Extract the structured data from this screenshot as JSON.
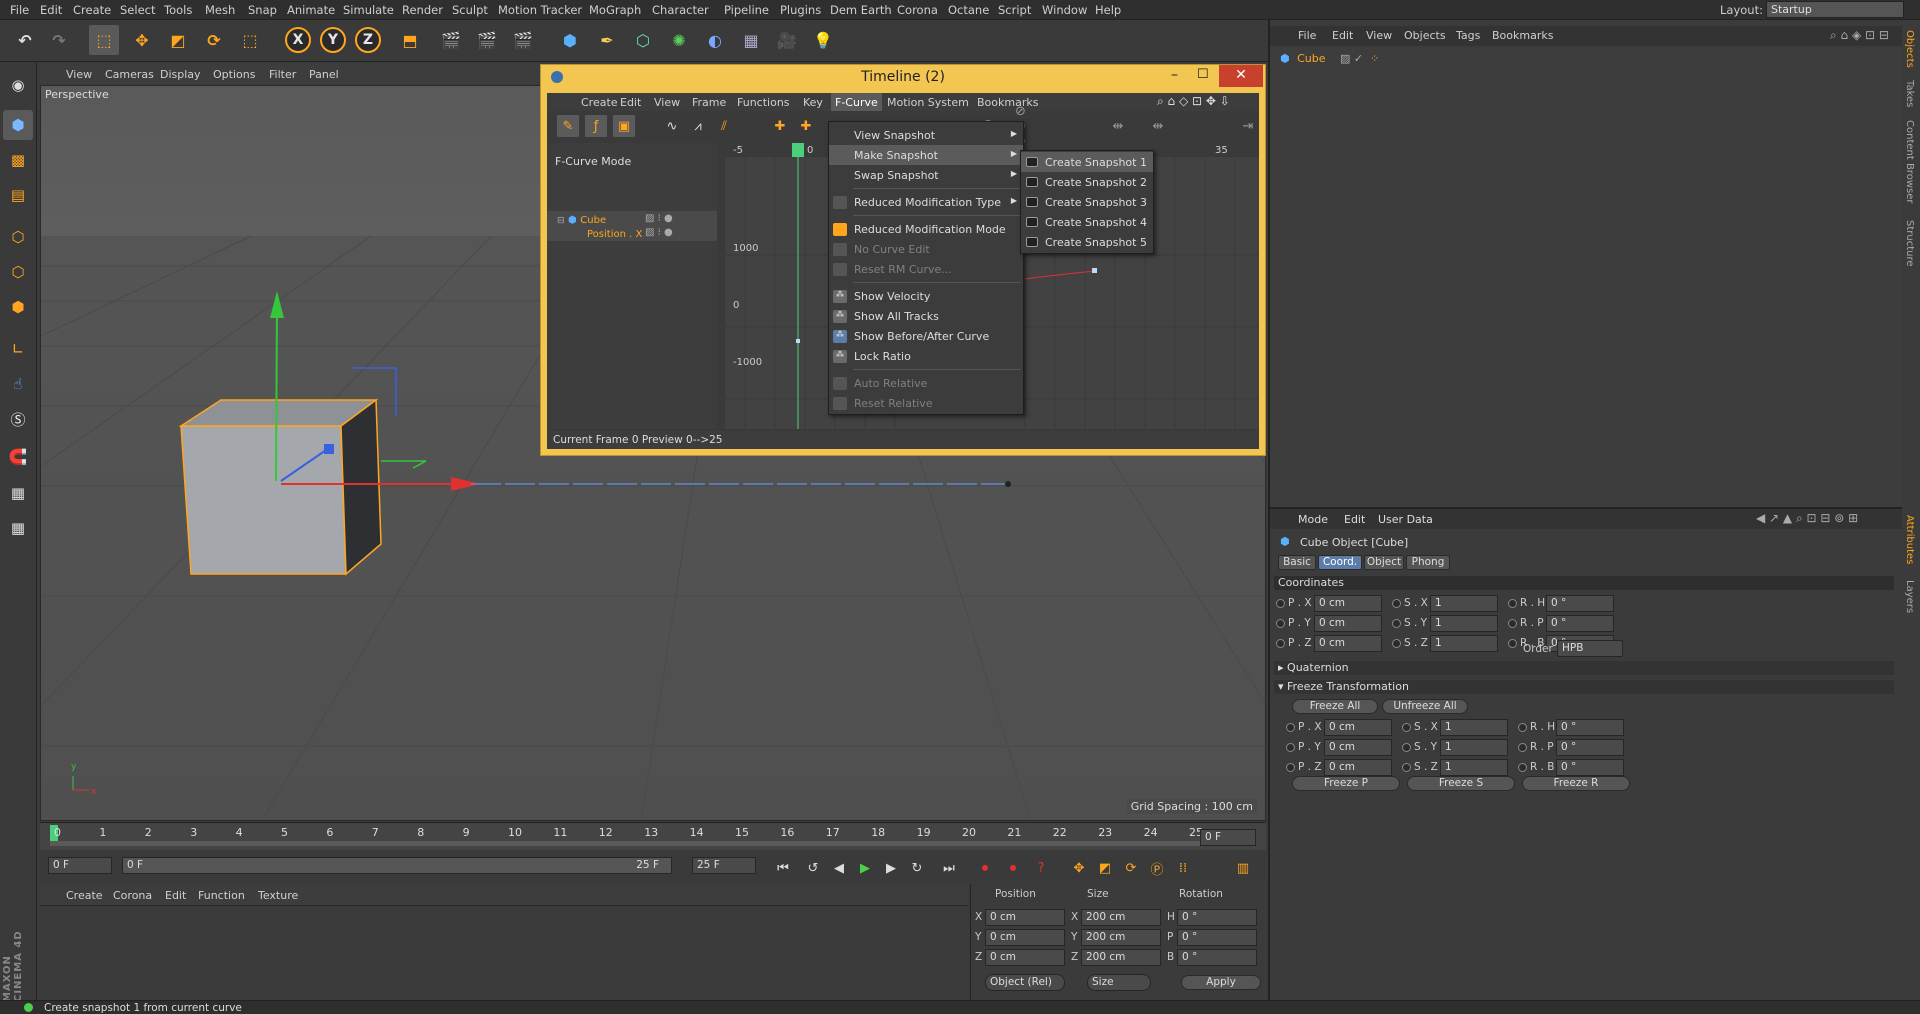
{
  "menubar": {
    "items": [
      "File",
      "Edit",
      "Create",
      "Select",
      "Tools",
      "Mesh",
      "Snap",
      "Animate",
      "Simulate",
      "Render",
      "Sculpt",
      "Motion Tracker",
      "MoGraph",
      "Character",
      "Pipeline",
      "Plugins",
      "Dem Earth",
      "Corona",
      "Octane",
      "Script",
      "Window",
      "Help"
    ],
    "layout_label": "Layout:",
    "layout_value": "Startup"
  },
  "toolbar": {
    "axis_x": "X",
    "axis_y": "Y",
    "axis_z": "Z"
  },
  "viewport": {
    "menu": [
      "View",
      "Cameras",
      "Display",
      "Options",
      "Filter",
      "Panel"
    ],
    "camera_label": "Perspective",
    "grid_spacing": "Grid Spacing : 100 cm"
  },
  "timeline_ruler": {
    "ticks": [
      "0",
      "1",
      "2",
      "3",
      "4",
      "5",
      "6",
      "7",
      "8",
      "9",
      "10",
      "11",
      "12",
      "13",
      "14",
      "15",
      "16",
      "17",
      "18",
      "19",
      "20",
      "21",
      "22",
      "23",
      "24",
      "25"
    ],
    "current_frame": "0 F"
  },
  "transport": {
    "start_field": "0 F",
    "range_start": "0 F",
    "range_end": "25 F",
    "end_field": "25 F"
  },
  "material_manager": {
    "menu": [
      "Create",
      "Corona",
      "Edit",
      "Function",
      "Texture"
    ]
  },
  "coordinate_manager": {
    "headers": {
      "position": "Position",
      "size": "Size",
      "rotation": "Rotation"
    },
    "rows": [
      {
        "axis": "X",
        "pos": "0 cm",
        "size_axis": "X",
        "size": "200 cm",
        "rot_axis": "H",
        "rot": "0 °"
      },
      {
        "axis": "Y",
        "pos": "0 cm",
        "size_axis": "Y",
        "size": "200 cm",
        "rot_axis": "P",
        "rot": "0 °"
      },
      {
        "axis": "Z",
        "pos": "0 cm",
        "size_axis": "Z",
        "size": "200 cm",
        "rot_axis": "B",
        "rot": "0 °"
      }
    ],
    "mode_select": "Object (Rel)",
    "size_select": "Size",
    "apply_label": "Apply"
  },
  "status_bar": {
    "text": "Create snapshot 1 from current curve"
  },
  "object_manager": {
    "menu": [
      "File",
      "Edit",
      "View",
      "Objects",
      "Tags",
      "Bookmarks"
    ],
    "object_name": "Cube"
  },
  "side_tabs": [
    "Objects",
    "Takes",
    "Content Browser",
    "Structure"
  ],
  "side_tabs_lower": [
    "Attributes",
    "Layers"
  ],
  "attributes": {
    "menu": [
      "Mode",
      "Edit",
      "User Data"
    ],
    "object_title": "Cube Object [Cube]",
    "tabs": [
      "Basic",
      "Coord.",
      "Object",
      "Phong"
    ],
    "active_tab": "Coord.",
    "section_coordinates": "Coordinates",
    "coords": [
      {
        "p_label": "P . X",
        "p_val": "0 cm",
        "s_label": "S . X",
        "s_val": "1",
        "r_label": "R . H",
        "r_val": "0 °"
      },
      {
        "p_label": "P . Y",
        "p_val": "0 cm",
        "s_label": "S . Y",
        "s_val": "1",
        "r_label": "R . P",
        "r_val": "0 °"
      },
      {
        "p_label": "P . Z",
        "p_val": "0 cm",
        "s_label": "S . Z",
        "s_val": "1",
        "r_label": "R . B",
        "r_val": "0 °"
      }
    ],
    "order_label": "Order",
    "order_value": "HPB",
    "section_quaternion": "Quaternion",
    "section_freeze": "Freeze Transformation",
    "freeze_all": "Freeze All",
    "unfreeze_all": "Unfreeze All",
    "freeze_coords": [
      {
        "p_label": "P . X",
        "p_val": "0 cm",
        "s_label": "S . X",
        "s_val": "1",
        "r_label": "R . H",
        "r_val": "0 °"
      },
      {
        "p_label": "P . Y",
        "p_val": "0 cm",
        "s_label": "S . Y",
        "s_val": "1",
        "r_label": "R . P",
        "r_val": "0 °"
      },
      {
        "p_label": "P . Z",
        "p_val": "0 cm",
        "s_label": "S . Z",
        "s_val": "1",
        "r_label": "R . B",
        "r_val": "0 °"
      }
    ],
    "freeze_p": "Freeze P",
    "freeze_s": "Freeze S",
    "freeze_r": "Freeze R"
  },
  "timeline_window": {
    "title": "Timeline (2)",
    "menu": [
      "Create",
      "Edit",
      "View",
      "Frame",
      "Functions",
      "Key",
      "F-Curve",
      "Motion System",
      "Bookmarks"
    ],
    "active_menu": "F-Curve",
    "mode_label": "F-Curve Mode",
    "tracks": [
      {
        "name": "Cube"
      },
      {
        "name": "Position . X"
      }
    ],
    "frame_labels": [
      "-5",
      "0",
      "35"
    ],
    "value_labels": [
      "1000",
      "0",
      "-1000"
    ],
    "status": "Current Frame  0  Preview  0-->25"
  },
  "fcurve_menu": {
    "items": [
      {
        "label": "View Snapshot",
        "sub": true,
        "disabled": false
      },
      {
        "label": "Make Snapshot",
        "sub": true,
        "disabled": false,
        "highlight": true
      },
      {
        "label": "Swap Snapshot",
        "sub": true,
        "disabled": false
      },
      {
        "label": "Reduced Modification Type",
        "sub": true,
        "disabled": false
      },
      {
        "label": "Reduced Modification Mode",
        "disabled": false
      },
      {
        "label": "No Curve Edit",
        "disabled": true
      },
      {
        "label": "Reset RM Curve...",
        "disabled": true
      },
      {
        "label": "Show Velocity",
        "disabled": false
      },
      {
        "label": "Show All Tracks",
        "disabled": false
      },
      {
        "label": "Show Before/After Curve",
        "disabled": false
      },
      {
        "label": "Lock Ratio",
        "disabled": false
      },
      {
        "label": "Auto Relative",
        "disabled": true
      },
      {
        "label": "Reset Relative",
        "disabled": true
      }
    ]
  },
  "snapshot_submenu": {
    "items": [
      "Create Snapshot 1",
      "Create Snapshot 2",
      "Create Snapshot 3",
      "Create Snapshot 4",
      "Create Snapshot 5"
    ]
  },
  "branding": "MAXON CINEMA 4D"
}
